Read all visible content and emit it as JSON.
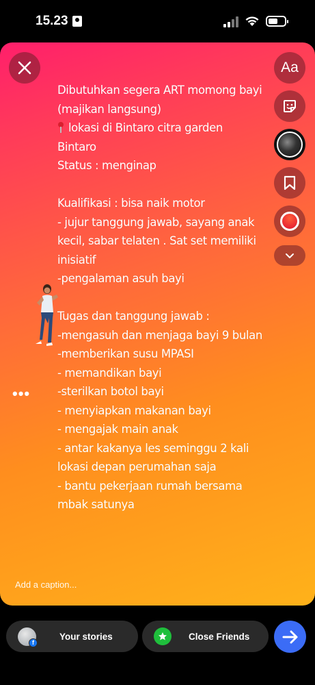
{
  "status_bar": {
    "time": "15.23"
  },
  "story": {
    "lines": [
      "Dibutuhkan segera ART momong bayi",
      "(majikan langsung)",
      "lokasi di Bintaro citra garden",
      "Bintaro",
      "Status : menginap",
      "",
      "Kualifikasi : bisa naik motor",
      "- jujur tanggung jawab, sayang anak",
      "kecil, sabar telaten . Sat set memiliki",
      "inisiatif",
      "-pengalaman asuh bayi",
      "",
      "Tugas dan tanggung jawab :",
      "-mengasuh dan menjaga bayi 9 bulan",
      "-memberikan susu MPASI",
      "- memandikan bayi",
      "-sterilkan botol bayi",
      "- menyiapkan makanan bayi",
      "- mengajak main anak",
      "- antar kakanya les seminggu 2 kali",
      "lokasi depan perumahan saja",
      "- bantu pekerjaan rumah bersama",
      "mbak satunya"
    ],
    "caption_placeholder": "Add a caption...",
    "colors": {
      "gradient_top": "#ff1f6b",
      "gradient_bottom": "#ffb21a"
    }
  },
  "tools": {
    "text_label": "Aa"
  },
  "bottom": {
    "your_stories": "Your stories",
    "close_friends": "Close Friends",
    "send_color": "#3b6cf6"
  }
}
